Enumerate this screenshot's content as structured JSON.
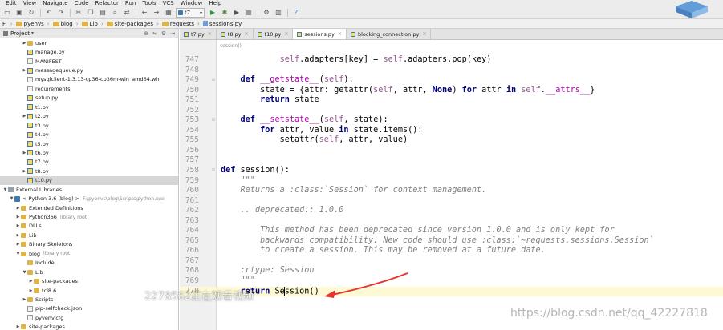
{
  "menu": [
    "Edit",
    "View",
    "Navigate",
    "Code",
    "Refactor",
    "Run",
    "Tools",
    "VCS",
    "Window",
    "Help"
  ],
  "toolbar": {
    "run_config": "t7"
  },
  "nav_breadcrumbs": [
    "F:",
    "pyenvs",
    "blog",
    "Lib",
    "site-packages",
    "requests",
    "sessions.py"
  ],
  "project": {
    "header_label": "Project",
    "rows": [
      {
        "label": "user",
        "indent": 3,
        "arrow": "right",
        "icon": "folder"
      },
      {
        "label": "manage.py",
        "indent": 3,
        "arrow": "",
        "icon": "py"
      },
      {
        "label": "MANIFEST",
        "indent": 3,
        "arrow": "",
        "icon": "file"
      },
      {
        "label": "messagequeue.py",
        "indent": 3,
        "arrow": "right",
        "icon": "py"
      },
      {
        "label": "mysqlclient-1.3.13-cp36-cp36m-win_amd64.whl",
        "indent": 3,
        "arrow": "",
        "icon": "file"
      },
      {
        "label": "requirements",
        "indent": 3,
        "arrow": "",
        "icon": "file"
      },
      {
        "label": "setup.py",
        "indent": 3,
        "arrow": "",
        "icon": "py"
      },
      {
        "label": "t1.py",
        "indent": 3,
        "arrow": "",
        "icon": "py"
      },
      {
        "label": "t2.py",
        "indent": 3,
        "arrow": "right",
        "icon": "py"
      },
      {
        "label": "t3.py",
        "indent": 3,
        "arrow": "",
        "icon": "py"
      },
      {
        "label": "t4.py",
        "indent": 3,
        "arrow": "",
        "icon": "py"
      },
      {
        "label": "t5.py",
        "indent": 3,
        "arrow": "",
        "icon": "py"
      },
      {
        "label": "t6.py",
        "indent": 3,
        "arrow": "right",
        "icon": "py"
      },
      {
        "label": "t7.py",
        "indent": 3,
        "arrow": "",
        "icon": "py"
      },
      {
        "label": "t8.py",
        "indent": 3,
        "arrow": "right",
        "icon": "py"
      },
      {
        "label": "t10.py",
        "indent": 3,
        "arrow": "",
        "icon": "py",
        "selected": true
      },
      {
        "label": "External Libraries",
        "indent": 0,
        "arrow": "down",
        "icon": "lib"
      },
      {
        "label": "< Python 3.6 (blog) >",
        "muted": "F:\\pyenvs\\blog\\Scripts\\python.exe",
        "indent": 1,
        "arrow": "down",
        "icon": "pyroot"
      },
      {
        "label": "Extended Definitions",
        "indent": 2,
        "arrow": "right",
        "icon": "folder"
      },
      {
        "label": "Python366",
        "muted": "library root",
        "indent": 2,
        "arrow": "right",
        "icon": "folder"
      },
      {
        "label": "DLLs",
        "indent": 2,
        "arrow": "right",
        "icon": "folder"
      },
      {
        "label": "Lib",
        "indent": 2,
        "arrow": "right",
        "icon": "folder"
      },
      {
        "label": "Binary Skeletons",
        "indent": 2,
        "arrow": "right",
        "icon": "folder"
      },
      {
        "label": "blog",
        "muted": "library root",
        "indent": 2,
        "arrow": "down",
        "icon": "folder"
      },
      {
        "label": "Include",
        "indent": 3,
        "arrow": "",
        "icon": "folder"
      },
      {
        "label": "Lib",
        "indent": 3,
        "arrow": "down",
        "icon": "folder"
      },
      {
        "label": "site-packages",
        "indent": 4,
        "arrow": "right",
        "icon": "folder"
      },
      {
        "label": "tcl8.6",
        "indent": 4,
        "arrow": "right",
        "icon": "folder"
      },
      {
        "label": "Scripts",
        "indent": 3,
        "arrow": "right",
        "icon": "folder"
      },
      {
        "label": "pip-selfcheck.json",
        "indent": 3,
        "arrow": "",
        "icon": "file"
      },
      {
        "label": "pyvenv.cfg",
        "indent": 3,
        "arrow": "",
        "icon": "file"
      },
      {
        "label": "site-packages",
        "indent": 2,
        "arrow": "right",
        "icon": "folder"
      }
    ]
  },
  "tabs": [
    {
      "label": "t7.py",
      "active": false
    },
    {
      "label": "t8.py",
      "active": false
    },
    {
      "label": "t10.py",
      "active": false
    },
    {
      "label": "sessions.py",
      "active": true
    },
    {
      "label": "blocking_connection.py",
      "active": false
    }
  ],
  "editor": {
    "structure_crumb": "session()",
    "lines": [
      {
        "n": "747",
        "code": "            self.adapters[key] = self.adapters.pop(key)"
      },
      {
        "n": "748",
        "code": ""
      },
      {
        "n": "749",
        "code": "    def __getstate__(self):",
        "fold": true
      },
      {
        "n": "750",
        "code": "        state = {attr: getattr(self, attr, None) for attr in self.__attrs__}"
      },
      {
        "n": "751",
        "code": "        return state"
      },
      {
        "n": "752",
        "code": ""
      },
      {
        "n": "753",
        "code": "    def __setstate__(self, state):",
        "fold": true
      },
      {
        "n": "754",
        "code": "        for attr, value in state.items():"
      },
      {
        "n": "755",
        "code": "            setattr(self, attr, value)"
      },
      {
        "n": "756",
        "code": ""
      },
      {
        "n": "757",
        "code": ""
      },
      {
        "n": "758",
        "code": "def session():",
        "fold": true
      },
      {
        "n": "759",
        "code": "    \"\"\""
      },
      {
        "n": "760",
        "code": "    Returns a :class:`Session` for context management."
      },
      {
        "n": "761",
        "code": ""
      },
      {
        "n": "762",
        "code": "    .. deprecated:: 1.0.0"
      },
      {
        "n": "763",
        "code": ""
      },
      {
        "n": "764",
        "code": "        This method has been deprecated since version 1.0.0 and is only kept for"
      },
      {
        "n": "765",
        "code": "        backwards compatibility. New code should use :class:`~requests.sessions.Session`"
      },
      {
        "n": "766",
        "code": "        to create a session. This may be removed at a future date."
      },
      {
        "n": "767",
        "code": ""
      },
      {
        "n": "768",
        "code": "    :rtype: Session"
      },
      {
        "n": "769",
        "code": "    \"\"\""
      },
      {
        "n": "770",
        "code": "    return Session()",
        "current": true
      }
    ]
  },
  "overlays": {
    "viewers_text": "2278562正在观看视频",
    "url_text": "https://blog.csdn.net/qq_42227818"
  },
  "colors": {
    "keyword": "#000080",
    "self": "#94558d",
    "dunder": "#b200b2",
    "docstring": "#808080",
    "current_line": "#fcf9d4",
    "annotation_arrow": "#e8332e"
  }
}
